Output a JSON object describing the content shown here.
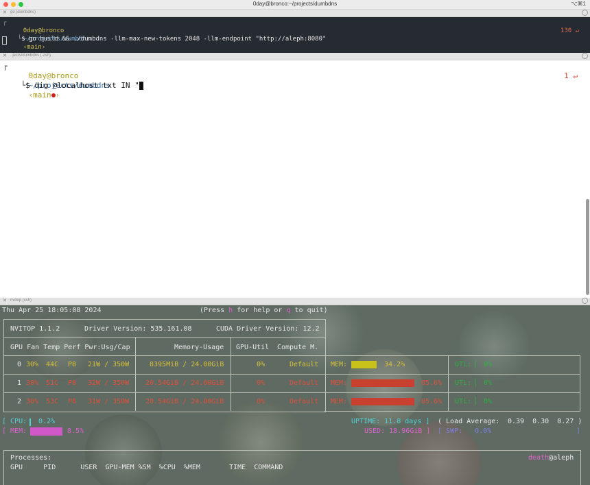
{
  "window": {
    "title": "0day@bronco:~/projects/dumbdns",
    "shortcut": "⌥⌘1",
    "colors": {
      "close": "#ff5f57",
      "minimize": "#febc2e",
      "zoom": "#28c840"
    }
  },
  "pane1": {
    "header_title": "go (dumbdns)",
    "user_host": "0day@bronco",
    "path": "~/projects/dumbdns",
    "branch": "‹main›",
    "prompt": "$",
    "command": "go build && ./dumbdns -llm-max-new-tokens 2048 -llm-endpoint \"http://aleph:8080\"",
    "exit_status": "130 ↵"
  },
  "pane2": {
    "header_title": "..jects/dumbdns (-zsh)",
    "user_host": "0day@bronco",
    "path": "~/projects/dumbdns",
    "branch_open": "‹main",
    "branch_close": "›",
    "prompt": "$",
    "command": "dig @localhost txt IN \"",
    "exit_status": "1 ↵"
  },
  "pane3": {
    "header_title": "nvitop (ssh)",
    "datetime": "Thu Apr 25 18:05:08 2024",
    "help": {
      "pre": "(Press ",
      "h": "h",
      "mid": " for help or ",
      "q": "q",
      "post": " to quit)"
    },
    "nvitop_version": "NVITOP 1.1.2",
    "driver_version": "Driver Version: 535.161.08",
    "cuda_version": "CUDA Driver Version: 12.2",
    "headers": {
      "gpu": "GPU Fan Temp Perf Pwr:Usg/Cap",
      "memory": "Memory-Usage",
      "util": "GPU-Util",
      "compute": "Compute M."
    },
    "gpus": [
      {
        "id": "0",
        "fan": "30%",
        "temp": "44C",
        "perf": "P8",
        "pwr": "21W / 350W",
        "mem": "8395MiB / 24.00GiB",
        "util": "0%",
        "compute": "Default",
        "mem_label": "MEM:",
        "mem_pct": "34.2%",
        "mem_frac": 0.342,
        "bar_color": "#c8c21a",
        "util_label": "UTL: ▏ 0%"
      },
      {
        "id": "1",
        "fan": "30%",
        "temp": "51C",
        "perf": "P8",
        "pwr": "32W / 350W",
        "mem": "20.54GiB / 24.00GiB",
        "util": "0%",
        "compute": "Default",
        "mem_label": "MEM:",
        "mem_pct": "85.6%",
        "mem_frac": 0.856,
        "bar_color": "#c94030",
        "util_label": "UTL: ▏ 0%"
      },
      {
        "id": "2",
        "fan": "30%",
        "temp": "53C",
        "perf": "P8",
        "pwr": "31W / 350W",
        "mem": "20.54GiB / 24.00GiB",
        "util": "0%",
        "compute": "Default",
        "mem_label": "MEM:",
        "mem_pct": "85.6%",
        "mem_frac": 0.856,
        "bar_color": "#c94030",
        "util_label": "UTL: ▏ 0%"
      }
    ],
    "cpu": {
      "label": "[ CPU:",
      "value": "0.2%",
      "frac": 0.002
    },
    "mem": {
      "label": "[ MEM:",
      "value": "8.5%",
      "frac": 0.085
    },
    "uptime": "UPTIME: 11.8 days ]",
    "load_label": "( Load Average:",
    "load_values": "0.39  0.30  0.27 )",
    "used": "USED: 18.96GiB ]",
    "swp": "[ SWP:   0.0%",
    "swp_end": "]",
    "processes_label": "Processes:",
    "user": "death",
    "host": "@aleph",
    "process_columns": "GPU     PID      USER  GPU-MEM %SM  %CPU  %MEM       TIME  COMMAND"
  }
}
